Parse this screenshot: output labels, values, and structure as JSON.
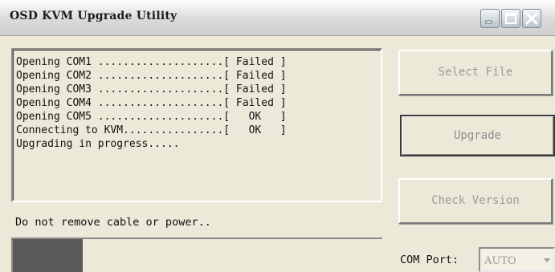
{
  "window": {
    "title": "OSD KVM Upgrade Utility",
    "controls": {
      "minimize_icon": "minimize-icon",
      "maximize_icon": "maximize-icon",
      "close_icon": "close-icon"
    }
  },
  "log": {
    "lines": [
      "Opening COM1 ....................[ Failed ]",
      "Opening COM2 ....................[ Failed ]",
      "Opening COM3 ....................[ Failed ]",
      "Opening COM4 ....................[ Failed ]",
      "Opening COM5 ....................[   OK   ]",
      "Connecting to KVM................[   OK   ]",
      "Upgrading in progress....."
    ]
  },
  "status": {
    "message": "Do not remove cable or power.."
  },
  "progress": {
    "fraction": 0.19,
    "fill_color": "#5a5a5a"
  },
  "buttons": {
    "select_file": "Select File",
    "upgrade": "Upgrade",
    "check_version": "Check Version"
  },
  "com_port": {
    "label": "COM Port:",
    "value": "AUTO"
  },
  "colors": {
    "window_bg": "#ece9d8",
    "disabled_text": "#9a9a9a"
  }
}
